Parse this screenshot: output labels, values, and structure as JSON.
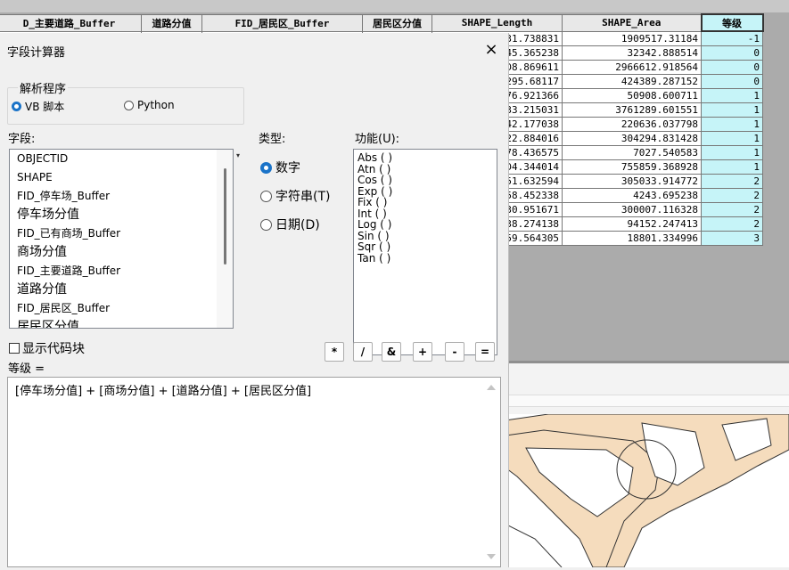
{
  "table": {
    "headers": [
      "D_主要道路_Buffer",
      "道路分值",
      "FID_居民区_Buffer",
      "居民区分值",
      "SHAPE_Length",
      "SHAPE_Area",
      "等级"
    ],
    "rows": [
      [
        "31.738831",
        "1909517.31184",
        "-1"
      ],
      [
        "45.365238",
        "32342.888514",
        "0"
      ],
      [
        "D8.869611",
        "2966612.918564",
        "0"
      ],
      [
        "295.68117",
        "424389.287152",
        "0"
      ],
      [
        "76.921366",
        "50908.600711",
        "1"
      ],
      [
        "33.215031",
        "3761289.601551",
        "1"
      ],
      [
        "42.177038",
        "220636.037798",
        "1"
      ],
      [
        "22.884016",
        "304294.831428",
        "1"
      ],
      [
        "78.436575",
        "7027.540583",
        "1"
      ],
      [
        "D4.344014",
        "755859.368928",
        "1"
      ],
      [
        "51.632594",
        "305033.914772",
        "2"
      ],
      [
        "58.452338",
        "4243.695238",
        "2"
      ],
      [
        "30.951671",
        "300007.116328",
        "2"
      ],
      [
        "38.274138",
        "94152.247413",
        "2"
      ],
      [
        "59.564305",
        "18801.334996",
        "3"
      ]
    ]
  },
  "dialog": {
    "title": "字段计算器",
    "close": "×",
    "parser": {
      "label": "解析程序",
      "options": [
        {
          "label": "VB 脚本",
          "selected": true
        },
        {
          "label": "Python",
          "selected": false
        }
      ]
    },
    "fields_label": "字段:",
    "fields": [
      {
        "text": "OBJECTID",
        "size": "s"
      },
      {
        "text": "SHAPE",
        "size": "s"
      },
      {
        "text": "FID_停车场_Buffer",
        "size": "s"
      },
      {
        "text": "停车场分值",
        "size": "l"
      },
      {
        "text": "FID_已有商场_Buffer",
        "size": "s"
      },
      {
        "text": "商场分值",
        "size": "l"
      },
      {
        "text": "FID_主要道路_Buffer",
        "size": "s"
      },
      {
        "text": "道路分值",
        "size": "l"
      },
      {
        "text": "FID_居民区_Buffer",
        "size": "s"
      },
      {
        "text": "居民区分值",
        "size": "l"
      }
    ],
    "type_label": "类型:",
    "types": [
      {
        "label": "数字",
        "selected": true
      },
      {
        "label": "字符串(T)",
        "selected": false
      },
      {
        "label": "日期(D)",
        "selected": false
      }
    ],
    "functions_label": "功能(U):",
    "functions": [
      "Abs ( )",
      "Atn ( )",
      "Cos ( )",
      "Exp ( )",
      "Fix ( )",
      "Int ( )",
      "Log ( )",
      "Sin ( )",
      "Sqr ( )",
      "Tan ( )"
    ],
    "show_codeblock": "显示代码块",
    "operators": [
      "*",
      "/",
      "&",
      "+",
      "-",
      "="
    ],
    "target_label": "等级 =",
    "expression": "[停车场分值] + [商场分值] + [道路分值] + [居民区分值]"
  },
  "colors": {
    "accent": "#1a73c8",
    "highlight_column": "#c6f4f8",
    "map_fill": "#f5dcbd"
  }
}
